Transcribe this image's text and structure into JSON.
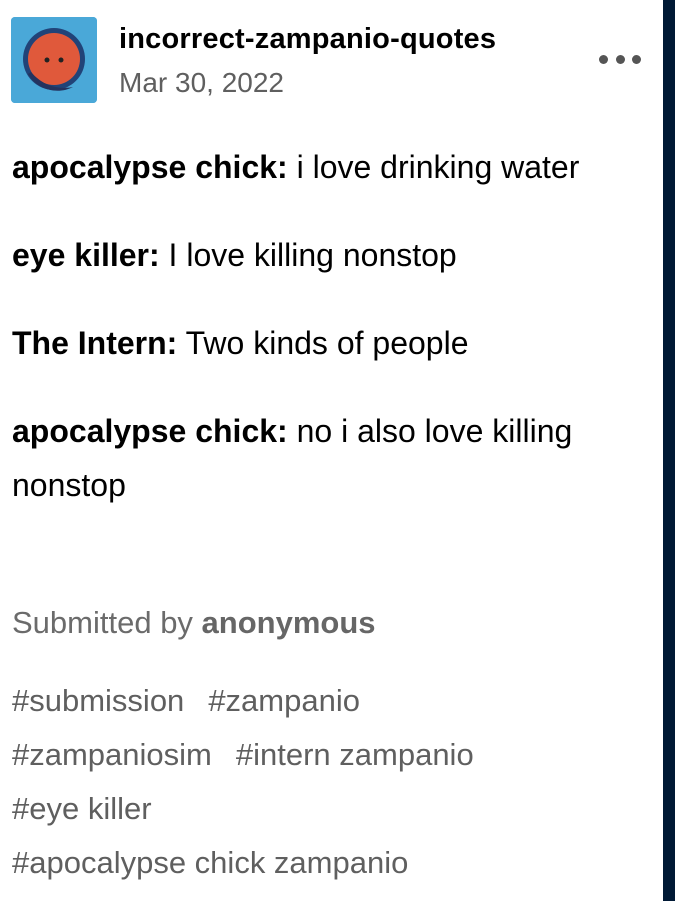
{
  "colors": {
    "avatar_background": "#4aa8d8",
    "avatar_face": "#e0593b",
    "right_edge": "#001935",
    "meta_text": "#5f5f5f"
  },
  "header": {
    "blog_name": "incorrect-zampanio-quotes",
    "date": "Mar 30, 2022",
    "avatar_icon": "orange-face-avatar",
    "menu_icon": "more-dots-icon"
  },
  "chat": [
    {
      "speaker": "apocalypse chick:",
      "text": " i love drinking water"
    },
    {
      "speaker": "eye killer:",
      "text": " I love killing nonstop"
    },
    {
      "speaker": "The Intern:",
      "text": " Two kinds of people"
    },
    {
      "speaker": "apocalypse chick:",
      "text": " no i also love killing nonstop"
    }
  ],
  "footer": {
    "submitted_prefix": "Submitted by ",
    "submitted_by": "anonymous"
  },
  "tags": [
    "#submission",
    "#zampanio",
    "#zampaniosim",
    "#intern zampanio",
    "#eye killer",
    "#apocalypse chick zampanio"
  ]
}
